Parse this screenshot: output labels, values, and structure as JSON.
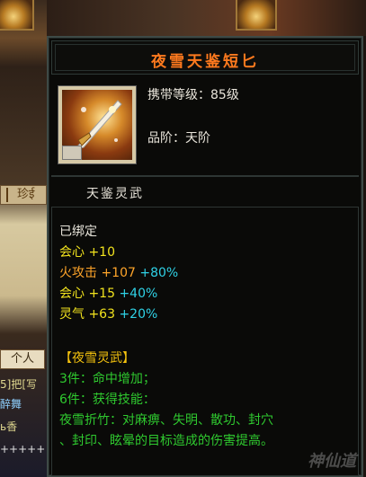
{
  "background": {
    "tab_label": "珍ई",
    "personal_label": "个人",
    "chat_lines": [
      "5]把[写",
      "醉舞",
      "ь香",
      "+++++"
    ]
  },
  "item": {
    "name": "夜雪天鉴短匕",
    "level_label": "携带等级：",
    "level_value": "85级",
    "grade_label": "品阶：",
    "grade_value": "天阶",
    "set_name": "天鉴灵武",
    "bound": "已绑定",
    "base_stat": {
      "name": "会心",
      "value": "+10"
    },
    "enhanced_stats": [
      {
        "name": "火攻击",
        "value": "+107",
        "bonus": "+80%"
      },
      {
        "name": "会心",
        "value": "+15",
        "bonus": "+40%"
      },
      {
        "name": "灵气",
        "value": "+63",
        "bonus": "+20%"
      }
    ],
    "set_title": "【夜雪灵武】",
    "set_bonus_3": "3件：命中增加；",
    "set_bonus_6": "6件：获得技能：",
    "skill_line_1": "夜雪折竹：对麻痹、失明、散功、封穴",
    "skill_line_2": "、封印、眩晕的目标造成的伤害提高。"
  },
  "watermark": "神仙道",
  "colors": {
    "title": "#ff7a1e",
    "set_title": "#f4c20e",
    "bonus": "#2fd2e6",
    "set_text": "#2fc92f"
  }
}
